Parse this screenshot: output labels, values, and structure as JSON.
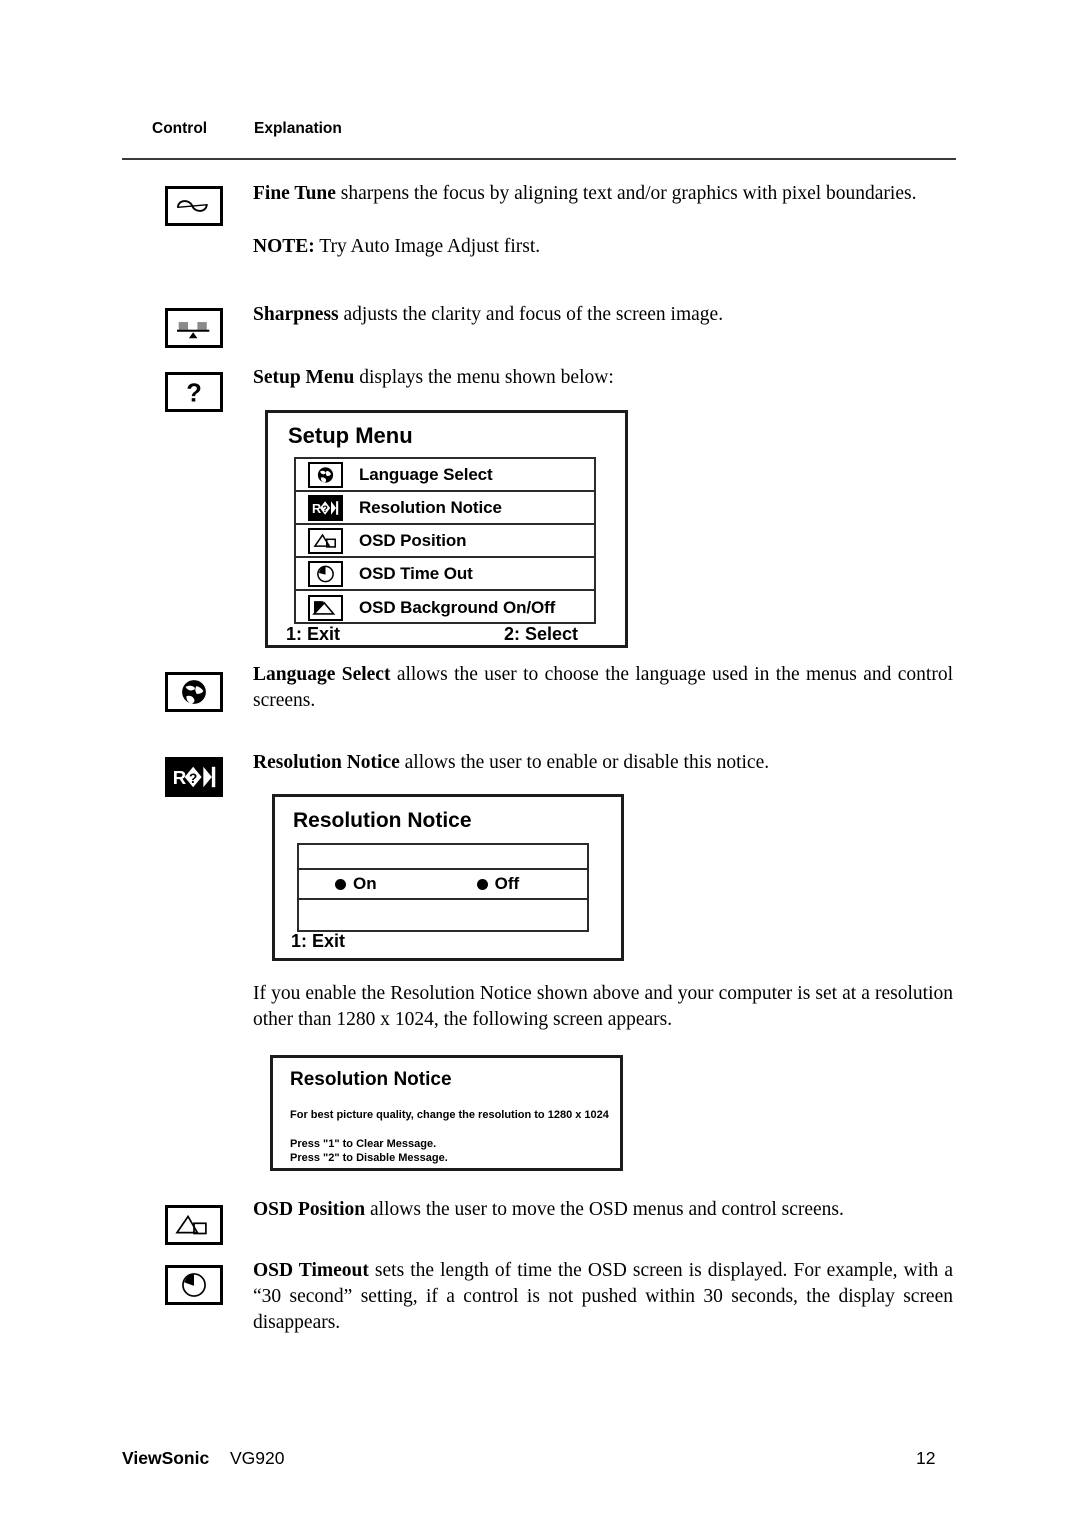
{
  "page": {
    "columns": {
      "control": "Control",
      "explanation": "Explanation"
    },
    "footer": {
      "brand": "ViewSonic",
      "model": "VG920",
      "page_number": "12"
    }
  },
  "entries": {
    "fine_tune": {
      "icon": "sine-wave-icon",
      "term": "Fine Tune",
      "text": " sharpens the focus by aligning text and/or graphics with pixel boundaries.",
      "note_label": "NOTE:",
      "note_text": " Try Auto Image Adjust first."
    },
    "sharpness": {
      "icon": "sharpness-icon",
      "term": "Sharpness",
      "text": " adjusts the clarity and focus of the screen image."
    },
    "setup_menu": {
      "icon": "question-mark-icon",
      "term": "Setup Menu",
      "text": " displays the menu shown below:"
    },
    "language_select": {
      "icon": "globe-icon",
      "term": "Language Select",
      "text": " allows the user to choose the language used in the menus and control screens."
    },
    "resolution_notice": {
      "icon": "resolution-notice-icon",
      "term": "Resolution Notice",
      "text": " allows the user to enable or disable this notice."
    },
    "resolution_paragraph": "If you enable the Resolution Notice shown above and your computer is set at a resolution other than 1280 x 1024, the following screen appears.",
    "osd_position": {
      "icon": "osd-position-icon",
      "term": "OSD Position",
      "text": " allows the user to move the OSD menus and control screens."
    },
    "osd_timeout": {
      "icon": "osd-timeout-icon",
      "term": "OSD Timeout",
      "text": " sets the length of time the OSD screen is displayed. For example, with a “30 second” setting, if a control is not pushed within 30 seconds, the display screen disappears."
    }
  },
  "osd_setup_menu": {
    "title": "Setup Menu",
    "items": [
      {
        "icon": "globe-icon",
        "label": "Language Select"
      },
      {
        "icon": "resolution-notice-icon",
        "label": "Resolution Notice"
      },
      {
        "icon": "osd-position-icon",
        "label": "OSD Position"
      },
      {
        "icon": "osd-timeout-icon",
        "label": "OSD Time Out"
      },
      {
        "icon": "osd-background-icon",
        "label": "OSD Background On/Off"
      }
    ],
    "footer_left": "1: Exit",
    "footer_right": "2: Select"
  },
  "osd_resolution_notice": {
    "title": "Resolution Notice",
    "option_on": "On",
    "option_off": "Off",
    "footer_left": "1: Exit"
  },
  "osd_resolution_message": {
    "title": "Resolution Notice",
    "message": "For best picture quality, change the resolution to 1280 x 1024",
    "line_clear": "Press \"1\" to Clear Message.",
    "line_disable": "Press \"2\" to Disable Message."
  }
}
